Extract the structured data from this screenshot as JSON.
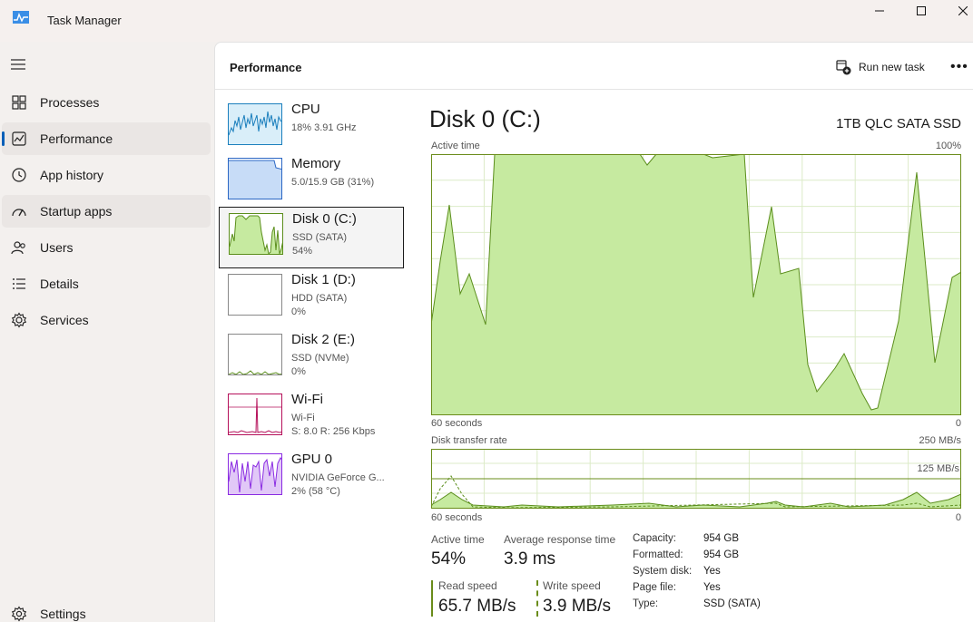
{
  "window": {
    "title": "Task Manager"
  },
  "nav": {
    "items": [
      {
        "label": "Processes",
        "icon": "processes-grid-icon"
      },
      {
        "label": "Performance",
        "icon": "performance-graph-icon",
        "active": true
      },
      {
        "label": "App history",
        "icon": "app-history-icon"
      },
      {
        "label": "Startup apps",
        "icon": "startup-gauge-icon"
      },
      {
        "label": "Users",
        "icon": "users-icon"
      },
      {
        "label": "Details",
        "icon": "details-list-icon"
      },
      {
        "label": "Services",
        "icon": "services-gear-icon"
      }
    ],
    "settings_label": "Settings"
  },
  "header": {
    "title": "Performance",
    "run_task_label": "Run new task",
    "more_label": "•••"
  },
  "devices": [
    {
      "name": "CPU",
      "sub1": "18% 3.91 GHz",
      "sub2": "",
      "color": "#1b7fbd"
    },
    {
      "name": "Memory",
      "sub1": "5.0/15.9 GB (31%)",
      "sub2": "",
      "color": "#2b67c4"
    },
    {
      "name": "Disk 0 (C:)",
      "sub1": "SSD (SATA)",
      "sub2": "54%",
      "color": "#5b8e1c",
      "selected": true
    },
    {
      "name": "Disk 1 (D:)",
      "sub1": "HDD (SATA)",
      "sub2": "0%",
      "color": "#5b8e1c"
    },
    {
      "name": "Disk 2 (E:)",
      "sub1": "SSD (NVMe)",
      "sub2": "0%",
      "color": "#5b8e1c"
    },
    {
      "name": "Wi-Fi",
      "sub1": "Wi-Fi",
      "sub2": "S: 8.0  R: 256 Kbps",
      "color": "#b5105a"
    },
    {
      "name": "GPU 0",
      "sub1": "NVIDIA GeForce G...",
      "sub2": "2%  (58 °C)",
      "color": "#8a2be2"
    }
  ],
  "detail": {
    "title": "Disk 0 (C:)",
    "model": "1TB QLC SATA SSD",
    "active_time_label": "Active time",
    "active_time_max": "100%",
    "seconds_label": "60 seconds",
    "zero": "0",
    "transfer_label": "Disk transfer rate",
    "transfer_max": "250 MB/s",
    "transfer_mid": "125 MB/s",
    "stats": {
      "active_time": {
        "label": "Active time",
        "value": "54%"
      },
      "avg_response": {
        "label": "Average response time",
        "value": "3.9 ms"
      },
      "read_speed": {
        "label": "Read speed",
        "value": "65.7 MB/s"
      },
      "write_speed": {
        "label": "Write speed",
        "value": "3.9 MB/s"
      }
    },
    "properties": [
      {
        "key": "Capacity:",
        "value": "954 GB"
      },
      {
        "key": "Formatted:",
        "value": "954 GB"
      },
      {
        "key": "System disk:",
        "value": "Yes"
      },
      {
        "key": "Page file:",
        "value": "Yes"
      },
      {
        "key": "Type:",
        "value": "SSD (SATA)"
      }
    ]
  },
  "colors": {
    "accent": "#005fb8",
    "disk_fill": "#c6eaa0",
    "disk_line": "#5b8e1c"
  }
}
